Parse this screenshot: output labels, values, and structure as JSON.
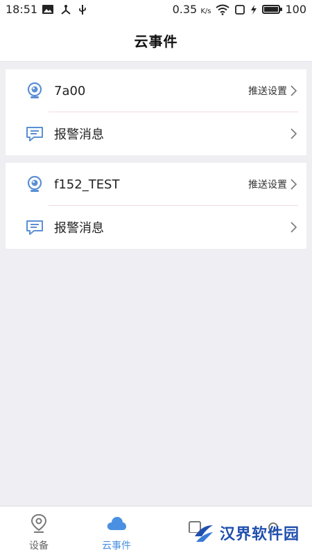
{
  "status_bar": {
    "time": "18:51",
    "speed": "0.35",
    "speed_unit": "K/s",
    "battery": "100",
    "battery_level": 1.0
  },
  "header": {
    "title": "云事件"
  },
  "devices": [
    {
      "name": "7a00",
      "push_label": "推送设置",
      "alarm_label": "报警消息"
    },
    {
      "name": "f152_TEST",
      "push_label": "推送设置",
      "alarm_label": "报警消息"
    }
  ],
  "bottom_nav": {
    "items": [
      {
        "label": "设备",
        "icon": "location-pin-icon",
        "active": false
      },
      {
        "label": "云事件",
        "icon": "cloud-icon",
        "active": true
      },
      {
        "label": "",
        "icon": "tablet-icon",
        "active": false
      },
      {
        "label": "",
        "icon": "user-icon",
        "active": false
      }
    ]
  },
  "watermark": {
    "text": "汉界软件园"
  },
  "colors": {
    "accent": "#4a90e2",
    "background": "#efeef2",
    "divider": "#f0d9e4"
  }
}
